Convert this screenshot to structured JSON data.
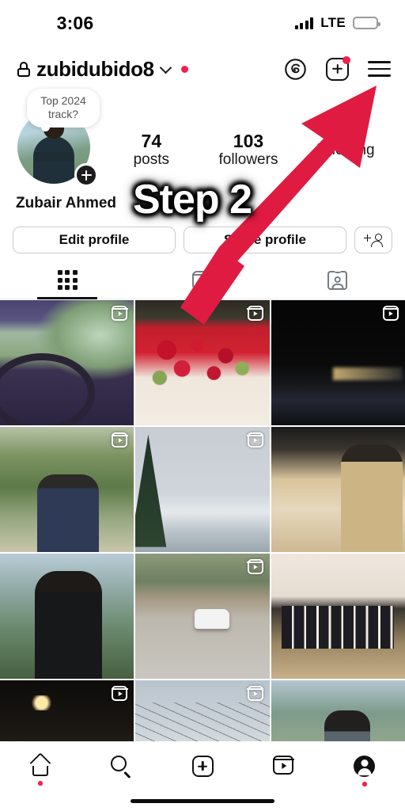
{
  "status_bar": {
    "time": "3:06",
    "network": "LTE",
    "signal_icon": "signal-bars-icon",
    "battery_icon": "battery-low-icon",
    "battery_level_pct": 14,
    "battery_color": "#e8243c"
  },
  "header": {
    "lock_icon": "lock-icon",
    "username": "zubidubido8",
    "chevron_icon": "chevron-down-icon",
    "notification_dot_color": "#f2204e",
    "actions": [
      {
        "name": "threads-icon",
        "label": "Threads"
      },
      {
        "name": "new-post-icon",
        "label": "New post",
        "badge": true
      },
      {
        "name": "menu-icon",
        "label": "Menu"
      }
    ]
  },
  "profile": {
    "note": "Top 2024 track?",
    "avatar_icon": "profile-avatar",
    "avatar_add_icon": "add-story-plus-icon",
    "display_name": "Zubair Ahmed",
    "stats": [
      {
        "value": "74",
        "label": "posts"
      },
      {
        "value": "103",
        "label": "followers"
      },
      {
        "value": "",
        "label": "following"
      }
    ]
  },
  "actions": {
    "edit_profile": "Edit profile",
    "share_profile": "Share profile",
    "add_person_icon": "add-person-icon"
  },
  "tabs": [
    {
      "name": "tab-grid",
      "icon": "grid-icon",
      "active": true
    },
    {
      "name": "tab-reels",
      "icon": "reels-icon",
      "active": false
    },
    {
      "name": "tab-tagged",
      "icon": "tagged-icon",
      "active": false
    }
  ],
  "grid": {
    "posts": [
      {
        "name": "post-car-interior-day",
        "thumb": "t-car-day",
        "is_reel": true
      },
      {
        "name": "post-red-roses",
        "thumb": "t-roses",
        "is_reel": true
      },
      {
        "name": "post-night-driving",
        "thumb": "t-night-drive",
        "is_reel": true
      },
      {
        "name": "post-man-forest-blazer",
        "thumb": "t-forest-man",
        "is_reel": true
      },
      {
        "name": "post-snowy-mountain",
        "thumb": "t-snow-mtn",
        "is_reel": true
      },
      {
        "name": "post-man-with-child-wedding",
        "thumb": "t-wedding-kid",
        "is_reel": false
      },
      {
        "name": "post-man-black-sweater-mountains",
        "thumb": "t-mtn-man",
        "is_reel": false
      },
      {
        "name": "post-white-car-mountain-road",
        "thumb": "t-road-car",
        "is_reel": true
      },
      {
        "name": "post-group-of-men-event",
        "thumb": "t-group",
        "is_reel": false
      },
      {
        "name": "post-tunnel-night",
        "thumb": "t-tunnel",
        "is_reel": true
      },
      {
        "name": "post-sky-power-lines",
        "thumb": "t-wires",
        "is_reel": true
      },
      {
        "name": "post-man-grey-shirt-village",
        "thumb": "t-village-man",
        "is_reel": false
      }
    ]
  },
  "overlay": {
    "step_text": "Step 2",
    "arrow_color": "#e01b42",
    "arrow_icon": "pointer-arrow-icon",
    "arrow_points_to": "menu-icon"
  },
  "bottom_nav": [
    {
      "name": "nav-home",
      "icon": "home-icon",
      "dot": true
    },
    {
      "name": "nav-search",
      "icon": "search-icon",
      "dot": false
    },
    {
      "name": "nav-create",
      "icon": "plus-square-icon",
      "dot": false
    },
    {
      "name": "nav-reels",
      "icon": "reels-icon",
      "dot": false
    },
    {
      "name": "nav-profile",
      "icon": "profile-avatar-icon",
      "dot": true
    }
  ]
}
